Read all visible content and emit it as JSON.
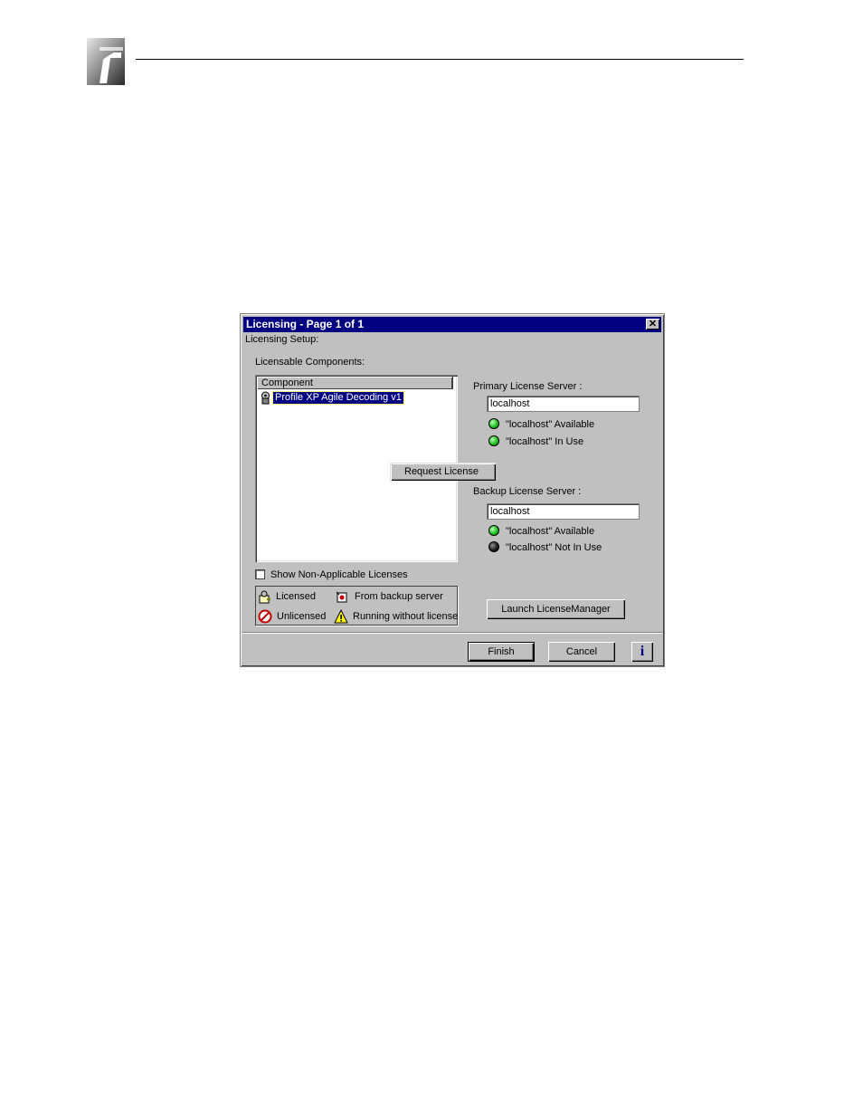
{
  "dialog": {
    "title": "Licensing - Page 1 of 1",
    "setup_label": "Licensing Setup:",
    "components_label": "Licensable Components:",
    "column_header": "Component",
    "component_item": "Profile XP Agile Decoding v1",
    "context_menu_item": "Request License",
    "show_non_applicable": "Show Non-Applicable Licenses",
    "show_non_applicable_checked": false,
    "legend": {
      "licensed": "Licensed",
      "from_backup": "From backup server",
      "unlicensed": "Unlicensed",
      "running_without": "Running without license"
    },
    "primary": {
      "label": "Primary License Server :",
      "value": "localhost",
      "status1": "\"localhost\" Available",
      "status2": "\"localhost\" In Use"
    },
    "backup": {
      "label": "Backup License Server :",
      "value": "localhost",
      "status1": "\"localhost\" Available",
      "status2": "\"localhost\" Not In Use"
    },
    "launch_button": "Launch LicenseManager",
    "finish_button": "Finish",
    "cancel_button": "Cancel",
    "info_button": "i",
    "close_button": "✕"
  },
  "colors": {
    "titlebar": "#000080",
    "dialog_bg": "#c0c0c0",
    "led_green": "#20c020",
    "led_off": "#202020"
  },
  "icons": [
    "document-logo-icon",
    "license-key-icon",
    "licensed-icon",
    "backup-server-icon",
    "unlicensed-icon",
    "warning-icon",
    "info-icon",
    "close-icon"
  ]
}
